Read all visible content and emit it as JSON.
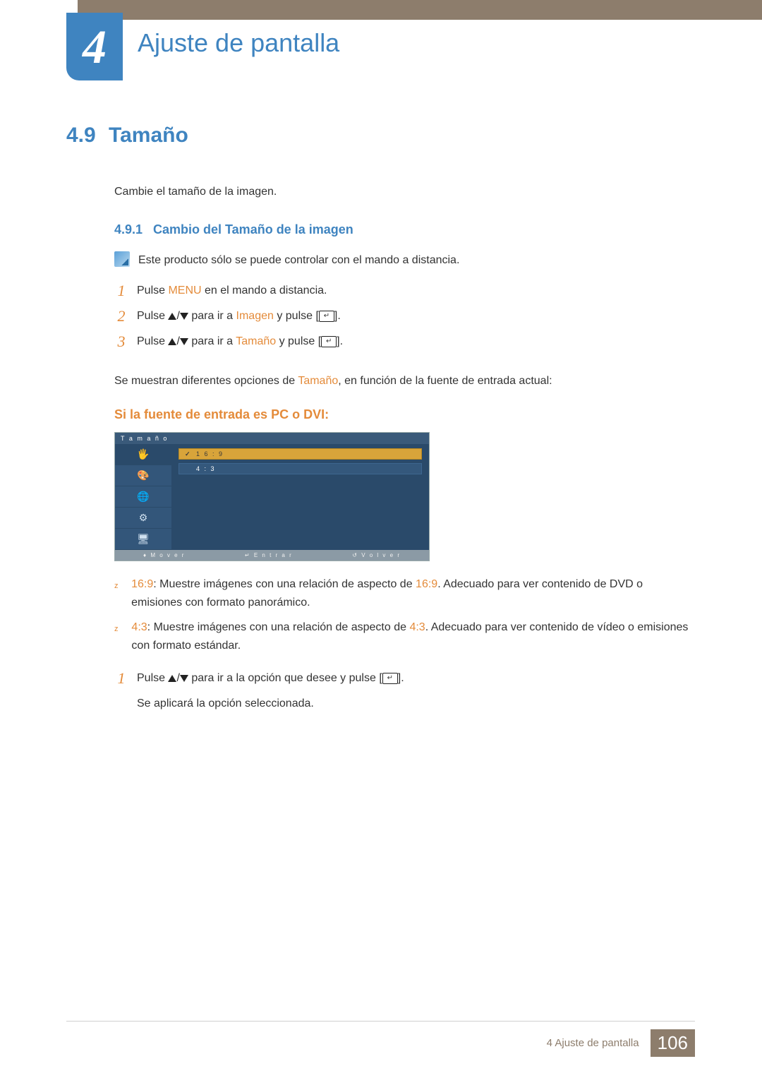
{
  "chapter": {
    "number": "4",
    "title": "Ajuste de pantalla"
  },
  "section": {
    "number": "4.9",
    "title": "Tamaño",
    "intro": "Cambie el tamaño de la imagen."
  },
  "subsection": {
    "number": "4.9.1",
    "title": "Cambio del Tamaño de la imagen"
  },
  "note": "Este producto sólo se puede controlar con el mando a distancia.",
  "steps": {
    "s1_a": "Pulse ",
    "s1_hl": "MENU",
    "s1_b": " en el mando a distancia.",
    "s2_a": "Pulse ",
    "s2_b": " para ir a ",
    "s2_hl": "Imagen",
    "s2_c": " y pulse [",
    "s3_a": "Pulse ",
    "s3_b": " para ir a ",
    "s3_hl": "Tamaño",
    "s3_c": " y pulse [",
    "close": "]."
  },
  "after_steps_a": "Se muestran diferentes opciones de ",
  "after_steps_hl": "Tamaño",
  "after_steps_b": ", en función de la fuente de entrada actual:",
  "source_heading": "Si la fuente de entrada es PC o DVI:",
  "osd": {
    "title": "T a m a ñ o",
    "opt1": "1 6 : 9",
    "opt2": "4 : 3",
    "foot1": "M o v e r",
    "foot2": "E n t r a r",
    "foot3": "V o l v e r"
  },
  "bullets": {
    "b1_hl1": "16:9",
    "b1_a": ": Muestre imágenes con una relación de aspecto de ",
    "b1_hl2": "16:9",
    "b1_b": ". Adecuado para ver contenido de DVD o emisiones con formato panorámico.",
    "b2_hl1": "4:3",
    "b2_a": ": Muestre imágenes con una relación de aspecto de ",
    "b2_hl2": "4:3",
    "b2_b": ". Adecuado para ver contenido de vídeo o emisiones con formato estándar."
  },
  "final": {
    "s1_a": "Pulse ",
    "s1_b": " para ir a la opción que desee y pulse [",
    "s1_c": "].",
    "p": "Se aplicará la opción seleccionada."
  },
  "footer": {
    "text": "4 Ajuste de pantalla",
    "page": "106"
  }
}
